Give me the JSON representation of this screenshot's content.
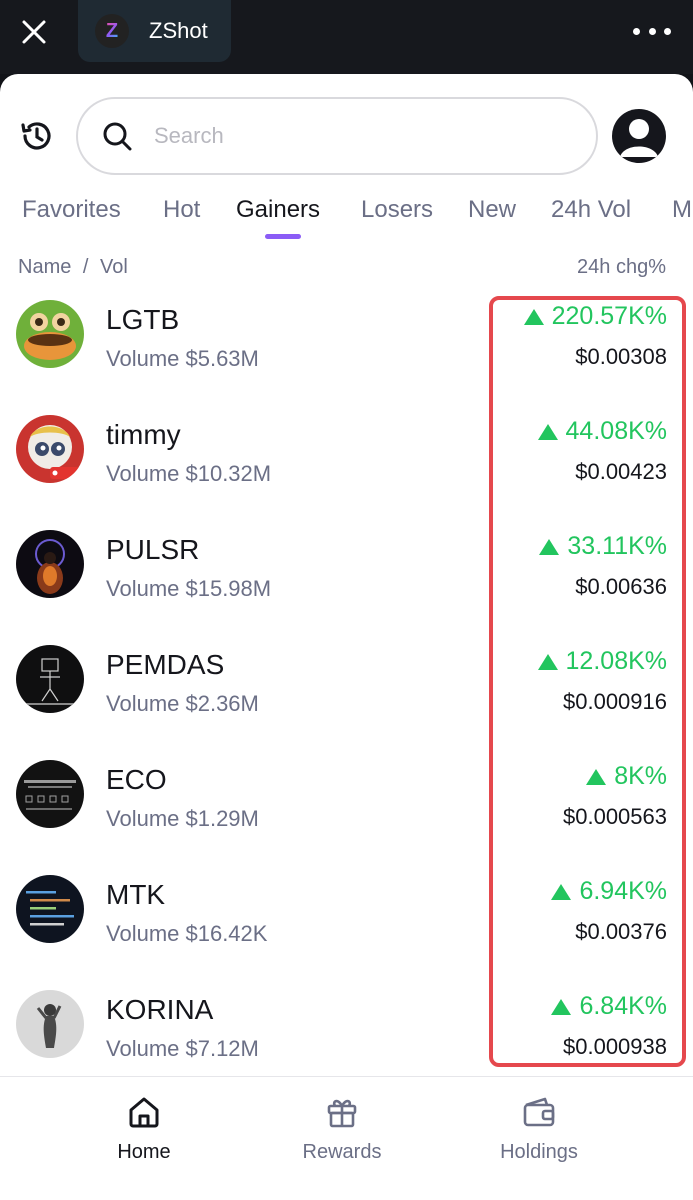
{
  "app": {
    "title": "ZShot",
    "logo_letter": "Z",
    "colors": {
      "accent": "#8b5cf6",
      "positive": "#22c55e",
      "highlight": "#e5484d"
    }
  },
  "search": {
    "placeholder": "Search"
  },
  "tabs": [
    {
      "label": "Favorites"
    },
    {
      "label": "Hot"
    },
    {
      "label": "Gainers"
    },
    {
      "label": "Losers"
    },
    {
      "label": "New"
    },
    {
      "label": "24h Vol"
    },
    {
      "label": "M"
    }
  ],
  "active_tab": "Gainers",
  "list_header": {
    "name": "Name",
    "sep": "/",
    "vol": "Vol",
    "change": "24h chg%"
  },
  "coins": [
    {
      "name": "LGTB",
      "volume": "Volume $5.63M",
      "change": "220.57K%",
      "price": "$0.00308"
    },
    {
      "name": "timmy",
      "volume": "Volume $10.32M",
      "change": "44.08K%",
      "price": "$0.00423"
    },
    {
      "name": "PULSR",
      "volume": "Volume $15.98M",
      "change": "33.11K%",
      "price": "$0.00636"
    },
    {
      "name": "PEMDAS",
      "volume": "Volume $2.36M",
      "change": "12.08K%",
      "price": "$0.000916"
    },
    {
      "name": "ECO",
      "volume": "Volume $1.29M",
      "change": "8K%",
      "price": "$0.000563"
    },
    {
      "name": "MTK",
      "volume": "Volume $16.42K",
      "change": "6.94K%",
      "price": "$0.00376"
    },
    {
      "name": "KORINA",
      "volume": "Volume $7.12M",
      "change": "6.84K%",
      "price": "$0.000938"
    }
  ],
  "bottom_nav": [
    {
      "label": "Home",
      "icon": "home-icon"
    },
    {
      "label": "Rewards",
      "icon": "gift-icon"
    },
    {
      "label": "Holdings",
      "icon": "wallet-icon"
    }
  ]
}
